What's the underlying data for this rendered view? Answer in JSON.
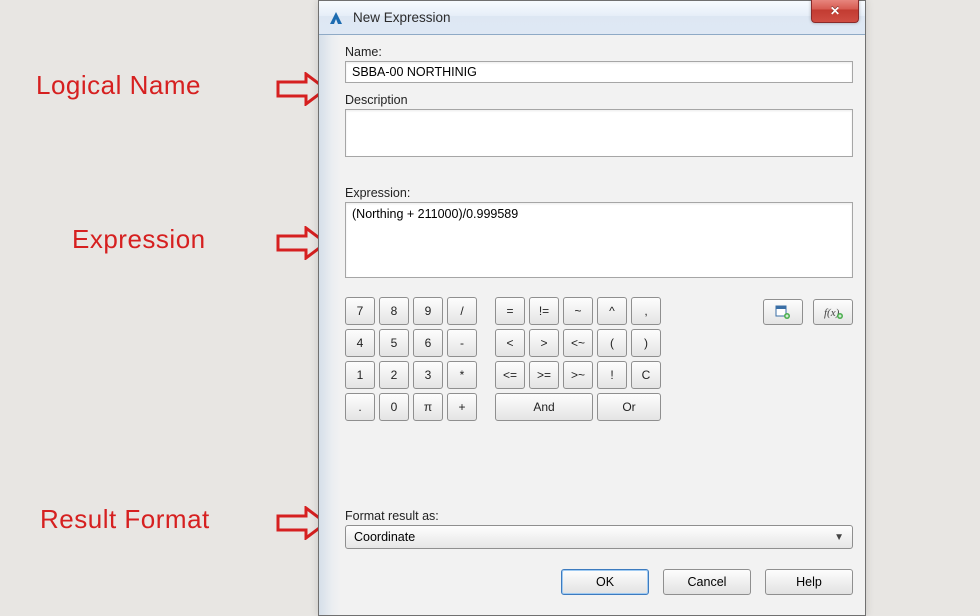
{
  "annotations": {
    "logical_name": "Logical Name",
    "expression": "Expression",
    "result_format": "Result Format"
  },
  "dialog": {
    "title": "New Expression",
    "name_label": "Name:",
    "name_value": "SBBA-00 NORTHINIG",
    "description_label": "Description",
    "description_value": "",
    "expression_label": "Expression:",
    "expression_value": "(Northing + 211000)/0.999589",
    "keypad": {
      "row1_col1": [
        "7",
        "8",
        "9",
        "/"
      ],
      "row2_col1": [
        "4",
        "5",
        "6",
        "-"
      ],
      "row3_col1": [
        "1",
        "2",
        "3",
        "*"
      ],
      "row4_col1": [
        ".",
        "0",
        "π",
        "+"
      ],
      "row1_col2": [
        "=",
        "!=",
        "~",
        "^",
        ","
      ],
      "row2_col2": [
        "<",
        ">",
        "<~",
        "(",
        ")"
      ],
      "row3_col2": [
        "<=",
        ">=",
        ">~",
        "!",
        "C"
      ],
      "and": "And",
      "or": "Or"
    },
    "icon_buttons": {
      "insert_property": "property-picker",
      "insert_function": "fx"
    },
    "format_label": "Format result as:",
    "format_value": "Coordinate",
    "buttons": {
      "ok": "OK",
      "cancel": "Cancel",
      "help": "Help"
    }
  }
}
